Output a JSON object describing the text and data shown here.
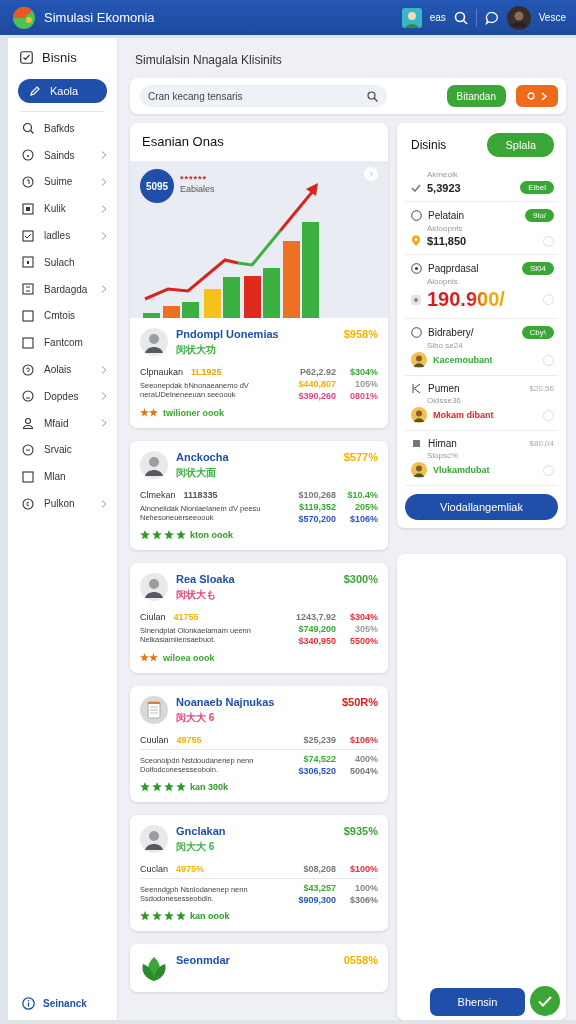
{
  "header": {
    "title": "Simulasi Ekomonia",
    "user_short": "eas",
    "user_name": "Vesce"
  },
  "sidebar": {
    "heading": "Bisnis",
    "primary_button": "Kaola",
    "items": [
      {
        "label": "Bafkds",
        "expandable": false
      },
      {
        "label": "Sainds",
        "expandable": true
      },
      {
        "label": "Suime",
        "expandable": true
      },
      {
        "label": "Kulik",
        "expandable": true
      },
      {
        "label": "ladles",
        "expandable": true
      },
      {
        "label": "Sulach",
        "expandable": false
      },
      {
        "label": "Bardagda",
        "expandable": true
      },
      {
        "label": "Cmtois",
        "expandable": false
      },
      {
        "label": "Fantcom",
        "expandable": false
      },
      {
        "label": "Aolais",
        "expandable": true
      },
      {
        "label": "Dopdes",
        "expandable": true
      },
      {
        "label": "Mfaid",
        "expandable": true
      },
      {
        "label": "Srvaic",
        "expandable": false
      },
      {
        "label": "Mlan",
        "expandable": false
      },
      {
        "label": "Pulkon",
        "expandable": true
      }
    ],
    "footer_link": "Seinanck"
  },
  "main": {
    "title": "Simulalsin Nnagala Klisinits",
    "search": {
      "placeholder": "Cran kecang tensaris"
    },
    "search_button": "Bitandan"
  },
  "featured": {
    "title": "Esanian Onas",
    "badge": "5095",
    "rating": "******",
    "label": "Eabiales"
  },
  "cards": [
    {
      "kind": "person",
      "name": "Pndompl Uonemias",
      "sub": {
        "text": "闵状大功",
        "color": "#3cb043"
      },
      "pct": {
        "text": "$958%",
        "color": "#f0b400"
      },
      "label": "Clpnaukan",
      "code": {
        "text": "1L1925",
        "color": "#f0a000"
      },
      "v1": {
        "text": "P62,2.92",
        "color": "#777777"
      },
      "p1": {
        "text": "$304%",
        "color": "#3aa635"
      },
      "divider": false,
      "desc": "Seeonepdak bNnonaeanemo dV neraUDelneneeuan seeoouk",
      "v2": {
        "text": "$440,807",
        "color": "#f0b400"
      },
      "p2": {
        "text": "105%",
        "color": "#999999"
      },
      "v3": {
        "text": "$390,260",
        "color": "#e8457a"
      },
      "p3": {
        "text": "0801%",
        "color": "#e8457a"
      },
      "rating": {
        "text": "★★",
        "color": "#e07800"
      },
      "footer": {
        "text": "twilioner oook",
        "color": "#3aa635"
      }
    },
    {
      "kind": "person",
      "name": "Anckocha",
      "sub": {
        "text": "闵状大面",
        "color": "#3cb043"
      },
      "pct": {
        "text": "$577%",
        "color": "#f0b400"
      },
      "label": "Clmekan",
      "code": {
        "text": "1118335",
        "color": "#555555"
      },
      "v1": {
        "text": "$100,268",
        "color": "#777777"
      },
      "p1": {
        "text": "$10.4%",
        "color": "#3aa635"
      },
      "divider": false,
      "desc": "Alnonelidak Nlonlaelanem dV peesu Nehesoneuerseeoouk",
      "v2": {
        "text": "$119,352",
        "color": "#3aa635"
      },
      "p2": {
        "text": "205%",
        "color": "#3aa635"
      },
      "v3": {
        "text": "$570,200",
        "color": "#2a55c0"
      },
      "p3": {
        "text": "$106%",
        "color": "#2a55c0"
      },
      "rating": {
        "stars": 4,
        "color": "#2f9a2a"
      },
      "footer": {
        "text": "kton oook",
        "color": "#2f9a2a"
      }
    },
    {
      "kind": "person",
      "name": "Rea Sloaka",
      "sub": {
        "text": "闵状大も",
        "color": "#e8457a"
      },
      "pct": {
        "text": "$300%",
        "color": "#3aa635"
      },
      "label": "Ciulan",
      "code": {
        "text": "41755",
        "color": "#f0b400"
      },
      "v1": {
        "text": "1243,7.92",
        "color": "#777777"
      },
      "p1": {
        "text": "$304%",
        "color": "#e0303a"
      },
      "divider": false,
      "desc": "Sinendpiat Olonkaelamam ueenn Nelkasiamiiensaebuot.",
      "v2": {
        "text": "$749,200",
        "color": "#3aa635"
      },
      "p2": {
        "text": "305%",
        "color": "#999999"
      },
      "v3": {
        "text": "$340,950",
        "color": "#e0303a"
      },
      "p3": {
        "text": "5500%",
        "color": "#e0303a"
      },
      "rating": {
        "text": "★★",
        "color": "#e07800"
      },
      "footer": {
        "text": "wiloea oook",
        "color": "#3aa635"
      }
    },
    {
      "kind": "document",
      "name": "Noanaeb Najnukas",
      "sub": {
        "text": "闵大大 6",
        "color": "#e8457a"
      },
      "pct": {
        "text": "$50R%",
        "color": "#d81e1e"
      },
      "label": "Cuulan",
      "code": {
        "text": "49755",
        "color": "#f0b400"
      },
      "v1": {
        "text": "$25,239",
        "color": "#777777"
      },
      "p1": {
        "text": "$106%",
        "color": "#e0303a"
      },
      "divider": true,
      "desc": "Sceonolpdn Nstdoudanenep nenn Doifodconesesseoboin.",
      "v2": {
        "text": "$74,522",
        "color": "#3aa635"
      },
      "p2": {
        "text": "400%",
        "color": "#888888"
      },
      "v3": {
        "text": "$306,520",
        "color": "#2a55c0"
      },
      "p3": {
        "text": "5004%",
        "color": "#777777"
      },
      "rating": {
        "stars": 4,
        "color": "#2f9a2a"
      },
      "footer": {
        "text": "kan 300k",
        "color": "#2f9a2a"
      }
    },
    {
      "kind": "person",
      "name": "Gnclakan",
      "sub": {
        "text": "闵大大 6",
        "color": "#3cb043"
      },
      "pct": {
        "text": "$935%",
        "color": "#3aa635"
      },
      "label": "Cuclan",
      "code": {
        "text": "4975%",
        "color": "#f0b400"
      },
      "v1": {
        "text": "$08,208",
        "color": "#777777"
      },
      "p1": {
        "text": "$100%",
        "color": "#e0303a"
      },
      "divider": true,
      "desc": "Seenndgph Nsnlodanenep nenn Ssdodonesesseobdin.",
      "v2": {
        "text": "$43,257",
        "color": "#3aa635"
      },
      "p2": {
        "text": "100%",
        "color": "#888888"
      },
      "v3": {
        "text": "$909,300",
        "color": "#2a55c0"
      },
      "p3": {
        "text": "$306%",
        "color": "#777777"
      },
      "rating": {
        "stars": 4,
        "color": "#2f9a2a"
      },
      "footer": {
        "text": "kan oook",
        "color": "#2f9a2a"
      }
    },
    {
      "kind": "plant",
      "name": "Seonmdar",
      "pct": {
        "text": "0558%",
        "color": "#f0b400"
      }
    }
  ],
  "panel": {
    "title": "Disinis",
    "header_button": "Splala",
    "items": [
      {
        "kind": "total",
        "caption": "Akmeolk",
        "value": "5,3923",
        "badge": "Eibel"
      },
      {
        "kind": "radio",
        "selected": false,
        "emphasis": false,
        "title": "Pelatain",
        "badge": "9lo/",
        "caption": "Aldoopnts",
        "value": "$11,850"
      },
      {
        "kind": "radio",
        "selected": true,
        "emphasis": true,
        "title": "Paqprdasal",
        "badge": "Sl04",
        "caption": "Aloopnis",
        "value": "190.900/"
      },
      {
        "kind": "radio",
        "selected": false,
        "title": "Bidrabery/",
        "badge": "Cby\\",
        "caption": "Sibo se24",
        "note": {
          "text": "Kacemoubant",
          "color": "#3aa635"
        }
      },
      {
        "kind": "plain",
        "title": "Pumen",
        "amount": "$20,56",
        "caption": "Oidsse36",
        "note": {
          "text": "Mokam dibant",
          "color": "#e0203a"
        }
      },
      {
        "kind": "plain",
        "title": "Himan",
        "amount": "$80,04",
        "caption": "Slopsc%",
        "note": {
          "text": "Vlukamdubat",
          "color": "#3aa635"
        }
      }
    ],
    "footer_button": "Viodallangemliak"
  },
  "actions": {
    "primary_button": "Bhensin"
  }
}
